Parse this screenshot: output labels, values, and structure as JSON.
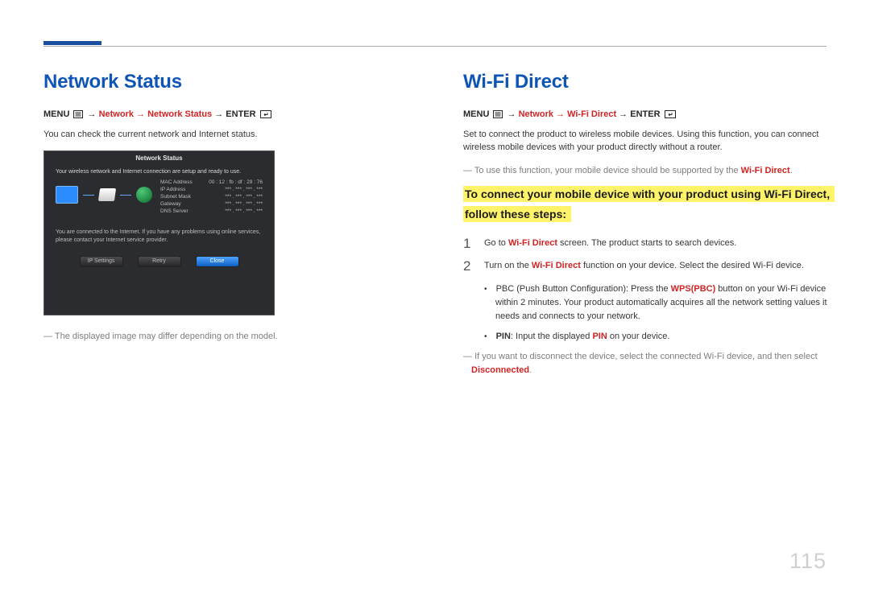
{
  "pageNumber": "115",
  "left": {
    "heading": "Network Status",
    "breadcrumb_menu": "MENU",
    "breadcrumb_path": "Network → Network Status",
    "breadcrumb_enter": "ENTER",
    "intro": "You can check the current network and Internet status.",
    "screenshot": {
      "title": "Network Status",
      "msg1": "Your wireless network and Internet connection are setup and ready to use.",
      "rows": [
        {
          "label": "MAC Address",
          "value": "00 : 12 : fb : df : 29 : 76"
        },
        {
          "label": "IP Address",
          "value": "*** . *** . *** . ***"
        },
        {
          "label": "Subnet Mask",
          "value": "*** . *** . *** . ***"
        },
        {
          "label": "Gateway",
          "value": "*** . *** . *** . ***"
        },
        {
          "label": "DNS Server",
          "value": "*** . *** . *** . ***"
        }
      ],
      "msg2": "You are connected to the Internet. If you have any problems using online services, please contact your Internet service provider.",
      "buttons": {
        "ip": "IP Settings",
        "retry": "Retry",
        "close": "Close"
      }
    },
    "note": "The displayed image may differ depending on the model."
  },
  "right": {
    "heading": "Wi-Fi Direct",
    "breadcrumb_menu": "MENU",
    "breadcrumb_path": "Network → Wi-Fi Direct",
    "breadcrumb_enter": "ENTER",
    "intro": "Set to connect the product to wireless mobile devices. Using this function, you can connect wireless mobile devices with your product directly without a router.",
    "note1_pre": "To use this function, your mobile device should be supported by the ",
    "note1_hl": "Wi-Fi Direct",
    "note1_post": ".",
    "subheading": "To connect your mobile device with your product using Wi-Fi Direct, follow these steps:",
    "steps": [
      {
        "num": "1",
        "pre": "Go to ",
        "hl": "Wi-Fi Direct",
        "post": " screen. The product starts to search devices."
      },
      {
        "num": "2",
        "pre": "Turn on the ",
        "hl": "Wi-Fi Direct",
        "post": " function on your device. Select the desired Wi-Fi device."
      }
    ],
    "bullets": [
      {
        "pre": "PBC (Push Button Configuration): Press the ",
        "hl": "WPS(PBC)",
        "post": " button on your Wi-Fi device within 2 minutes. Your product automatically acquires all the network setting values it needs and connects to your network."
      },
      {
        "pre2_bold": "PIN",
        "pre2_plain": ": Input the displayed ",
        "hl": "PIN",
        "post": " on your device.",
        "variant": "pin"
      }
    ],
    "note2_pre": "If you want to disconnect the device, select the connected Wi-Fi device, and then select ",
    "note2_hl": "Disconnected",
    "note2_post": "."
  }
}
